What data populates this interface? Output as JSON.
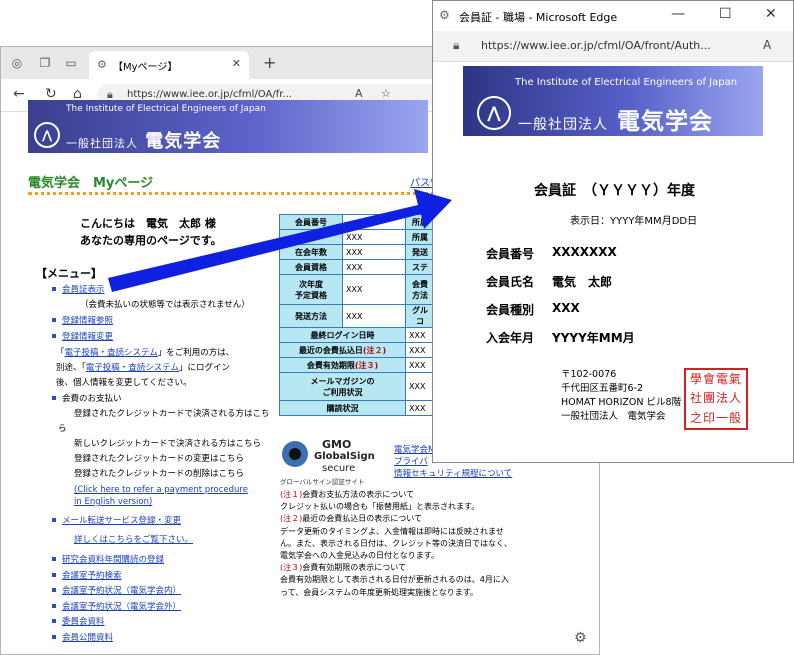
{
  "back_window": {
    "tab_title": "【Myページ】",
    "url": "https://www.iee.or.jp/cfml/OA/fr..."
  },
  "site": {
    "org_en": "The Institute of Electrical Engineers of Japan",
    "org_prefix": "一般社団法人",
    "org_name": "電気学会",
    "mypage_title": "電気学会　Myページ",
    "password_link": "パスワ",
    "greeting_line1": "こんにちは　電気　太郎 様",
    "greeting_line2": "あなたの専用のページです。",
    "menu_heading": "【メニュー】"
  },
  "menu": {
    "card": "会員証表示",
    "card_note": "（会費未払いの状態等では表示されません）",
    "reg_ref": "登録情報参照",
    "reg_change": "登録情報変更",
    "sys_note1_a": "「",
    "sys_link": "電子投稿・査読システム",
    "sys_note1_b": "」をご利用の方は、",
    "sys_note2_a": "別途、「",
    "sys_note2_b": "」にログイン",
    "sys_note3": "後、個人情報を変更してください。",
    "payment": "会費のお支払い",
    "pay1": "登録されたクレジットカードで決済される方はこち",
    "pay1b": "ら",
    "pay2": "新しいクレジットカードで決済される方はこちら",
    "pay3": "登録されたクレジットカードの変更はこちら",
    "pay4": "登録されたクレジットカードの削除はこちら",
    "pay_en1": "(Click here to refer a payment procedure",
    "pay_en2": "in English version)",
    "mail": "メール転送サービス登録・変更",
    "mail_detail": "詳しくはこちらをご覧下さい。",
    "research": "研究会資料年間購読の登録",
    "conf1": "会議室予約検索",
    "conf2": "会議室予約状況（電気学会内）",
    "conf3": "会議室予約状況（電気学会外）",
    "committee": "委員会資料",
    "public": "会員公開資料"
  },
  "table": {
    "rows": [
      {
        "label": "会員番号",
        "value": "",
        "label2": "所属",
        "value2": ""
      },
      {
        "label": "",
        "value": "XXX",
        "label2": "所属",
        "value2": ""
      },
      {
        "label": "在会年数",
        "value": "XXX",
        "label2": "発送",
        "value2": ""
      },
      {
        "label": "会員資格",
        "value": "XXX",
        "label2": "ステ",
        "value2": ""
      },
      {
        "label": "次年度\n予定資格",
        "value": "XXX",
        "label2": "会費\n方法",
        "value2": ""
      },
      {
        "label": "発送方法",
        "value": "XXX",
        "label2": "グル\nコ",
        "value2": ""
      }
    ],
    "wide_rows": [
      {
        "label": "最終ログイン日時",
        "value": "XXX"
      },
      {
        "label": "最近の会費払込日",
        "note": "(注２)",
        "value": "XXX"
      },
      {
        "label": "会費有効期限",
        "note": "(注３)",
        "value": "XXX"
      },
      {
        "label": "メールマガジンの\nご利用状況",
        "value": "XXX"
      },
      {
        "label": "購読状況",
        "value": "XXX"
      }
    ]
  },
  "gmo": {
    "brand": "GMO",
    "line1": "GlobalSign",
    "line2": "secure",
    "line3": "グローバルサイン認証サイト",
    "link1": "電気学会M",
    "link2": "プライバ",
    "link3": "情報セキュリティ規程について"
  },
  "notes": [
    {
      "mark": "(注１)",
      "text": "会費お支払方法の表示について"
    },
    {
      "mark": "",
      "text": "クレジット払いの場合も「振替用紙」と表示されます。"
    },
    {
      "mark": "(注２)",
      "text": "最近の会費払込日の表示について"
    },
    {
      "mark": "",
      "text": "データ更新のタイミングよ、入金情報は即時には反映されませ"
    },
    {
      "mark": "",
      "text": "ん。また、表示される日付は、クレジット等の決済日ではなく、"
    },
    {
      "mark": "",
      "text": "電気学会への入金見込みの日付となります。"
    },
    {
      "mark": "(注３)",
      "text": "会費有効期限の表示について"
    },
    {
      "mark": "",
      "text": "会費有効期限として表示される日付が更新されるのは、4月に入"
    },
    {
      "mark": "",
      "text": "って、会員システムの年度更新処理実施後となります。"
    }
  ],
  "front_window": {
    "title": "会員証 - 職場 - Microsoft Edge",
    "url": "https://www.iee.or.jp/cfml/OA/front/Auth...",
    "card_title": "会員証　（ＹＹＹＹ）年度",
    "display_date": "表示日：YYYY年MM月DD日",
    "fields": [
      {
        "label": "会員番号",
        "value": "XXXXXXX"
      },
      {
        "label": "会員氏名",
        "value": "電気　太郎"
      },
      {
        "label": "会員種別",
        "value": "XXX"
      },
      {
        "label": "入会年月",
        "value": "YYYY年MM月"
      }
    ],
    "address": [
      "〒102-0076",
      "千代田区五番町6-2",
      "HOMAT HORIZON ビル8階",
      "一般社団法人　電気学会"
    ],
    "seal_text": "一般社団法人電気学会之印"
  },
  "colors": {
    "banner": "#3a3f8f",
    "link": "#1a3fbf",
    "table_header": "#b6e7f3",
    "arrow": "#1020e0",
    "seal": "#d42020",
    "mypage_green": "#2a8a2a"
  }
}
